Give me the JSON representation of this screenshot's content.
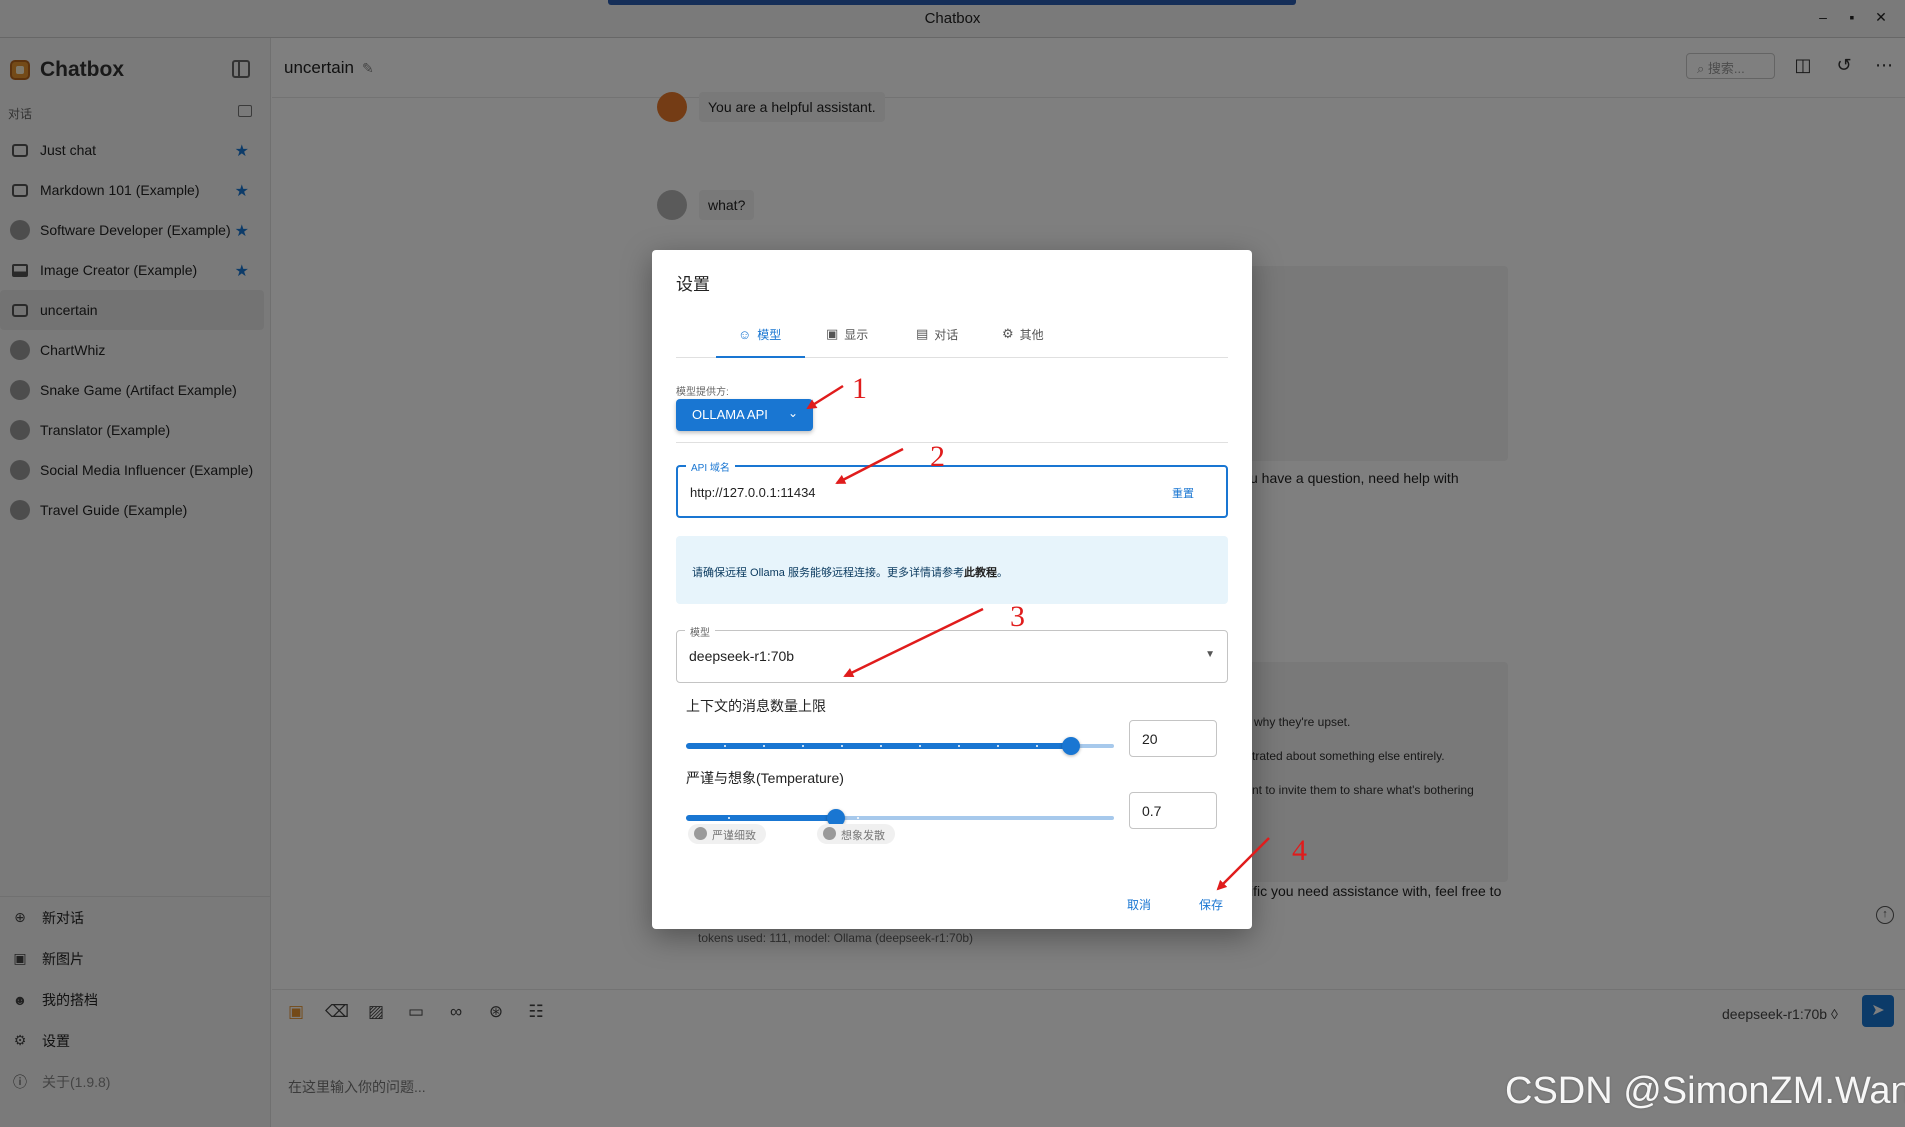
{
  "window": {
    "title": "Chatbox",
    "controls": {
      "minimize": "–",
      "maximize": "▪",
      "close": "✕"
    }
  },
  "sidebar": {
    "brand": "Chatbox",
    "section_label": "对话",
    "sessions": [
      {
        "label": "Just chat",
        "icon": "chat-icon",
        "starred": true
      },
      {
        "label": "Markdown 101 (Example)",
        "icon": "chat-icon",
        "starred": true
      },
      {
        "label": "Software Developer (Example)",
        "icon": "avatar-icon",
        "starred": true
      },
      {
        "label": "Image Creator (Example)",
        "icon": "image-icon",
        "starred": true
      },
      {
        "label": "uncertain",
        "icon": "chat-icon",
        "starred": false,
        "active": true
      },
      {
        "label": "ChartWhiz",
        "icon": "avatar-icon",
        "starred": false
      },
      {
        "label": "Snake Game (Artifact Example)",
        "icon": "avatar-icon",
        "starred": false
      },
      {
        "label": "Translator (Example)",
        "icon": "avatar-icon",
        "starred": false
      },
      {
        "label": "Social Media Influencer (Example)",
        "icon": "avatar-icon",
        "starred": false
      },
      {
        "label": "Travel Guide (Example)",
        "icon": "avatar-icon",
        "starred": false
      }
    ],
    "bottom": {
      "new_chat": "新对话",
      "new_image": "新图片",
      "my_copilots": "我的搭档",
      "settings": "设置",
      "about": "关于(1.9.8)"
    }
  },
  "header": {
    "session_title": "uncertain",
    "search_placeholder": "搜索..."
  },
  "chat": {
    "system_message": "You are a helpful assistant.",
    "user_message": "what?",
    "partial_1": "u have a question, need help with",
    "partial_2": "why they're upset.",
    "partial_3": "trated about something else entirely.",
    "partial_4": "nt to invite them to share what's bothering",
    "partial_5": "ific you need assistance with, feel free to",
    "tokens_info": "tokens used: 111, model: Ollama (deepseek-r1:70b)"
  },
  "input": {
    "placeholder": "在这里输入你的问题...",
    "model": "deepseek-r1:70b ◊"
  },
  "dialog": {
    "title": "设置",
    "tabs": {
      "model": "模型",
      "display": "显示",
      "chat": "对话",
      "other": "其他"
    },
    "provider_label": "模型提供方:",
    "provider_value": "OLLAMA API",
    "api_host_label": "API 域名",
    "api_host_value": "http://127.0.0.1:11434",
    "reset": "重置",
    "info_text": "请确保远程 Ollama 服务能够远程连接。更多详情请参考",
    "info_link": "此教程",
    "info_end": "。",
    "model_label": "模型",
    "model_value": "deepseek-r1:70b",
    "context_label": "上下文的消息数量上限",
    "context_value": "20",
    "context_fraction": 0.9,
    "temp_label": "严谨与想象(Temperature)",
    "temp_value": "0.7",
    "temp_fraction": 0.35,
    "chip_precise": "严谨细致",
    "chip_creative": "想象发散",
    "cancel": "取消",
    "save": "保存"
  },
  "annotations": {
    "n1": "1",
    "n2": "2",
    "n3": "3",
    "n4": "4",
    "color": "#e01c1c"
  },
  "watermark": "CSDN @SimonZM.Wang",
  "colors": {
    "accent": "#1976d2",
    "star": "#1976d2",
    "brand": "#e8952f"
  }
}
